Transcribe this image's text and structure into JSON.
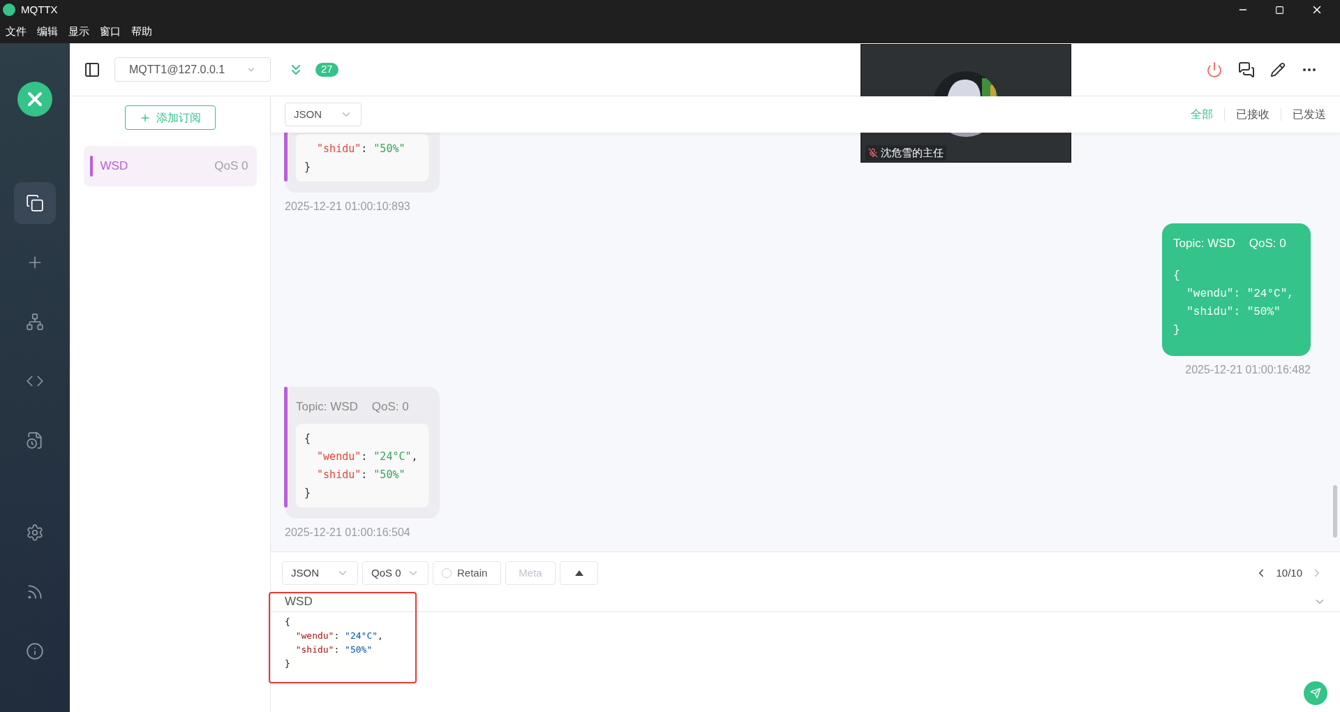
{
  "window": {
    "title": "MQTTX"
  },
  "menu": [
    "文件",
    "编辑",
    "显示",
    "窗口",
    "帮助"
  ],
  "nav": [
    {
      "kind": "connections",
      "selected": true
    },
    {
      "kind": "new",
      "selected": false
    },
    {
      "kind": "topology",
      "selected": false
    },
    {
      "kind": "script",
      "selected": false
    },
    {
      "kind": "log",
      "selected": false
    },
    {
      "kind": "settings",
      "selected": false
    },
    {
      "kind": "feed",
      "selected": false
    },
    {
      "kind": "about",
      "selected": false
    }
  ],
  "connection": {
    "name": "MQTT1@127.0.0.1",
    "unread": "27"
  },
  "subscriptions": {
    "add_button": "添加订阅",
    "items": [
      {
        "topic": "WSD",
        "qos": "QoS 0",
        "color": "#b95fd8",
        "selected": true
      }
    ]
  },
  "message_filter": {
    "format": "JSON",
    "tabs": [
      {
        "label": "全部",
        "selected": true
      },
      {
        "label": "已接收",
        "selected": false
      },
      {
        "label": "已发送",
        "selected": false
      }
    ]
  },
  "messages": [
    {
      "kind": "received",
      "payload": [
        "  \"shidu\": \"50%\"",
        "}"
      ],
      "time": "2025-12-21 01:00:10:893"
    },
    {
      "kind": "sent",
      "topic": "Topic: WSD",
      "qos": "QoS: 0",
      "payload": [
        "{",
        "  \"wendu\": \"24°C\",",
        "  \"shidu\": \"50%\"",
        "}"
      ],
      "time": "2025-12-21 01:00:16:482"
    },
    {
      "kind": "received",
      "topic": "Topic: WSD",
      "qos": "QoS: 0",
      "payload": [
        "{",
        "  \"wendu\": \"24°C\",",
        "  \"shidu\": \"50%\"",
        "}"
      ],
      "time": "2025-12-21 01:00:16:504"
    }
  ],
  "composer": {
    "format": "JSON",
    "qos": "QoS 0",
    "retain": {
      "label": "Retain",
      "checked": false
    },
    "meta": {
      "label": "Meta",
      "disabled": true
    },
    "page": "10/10",
    "topic": "WSD",
    "payload": [
      "{",
      "  \"wendu\": \"24°C\",",
      "  \"shidu\": \"50%\"",
      "}"
    ]
  },
  "video_overlay": {
    "name": "沈危雪的主任"
  }
}
